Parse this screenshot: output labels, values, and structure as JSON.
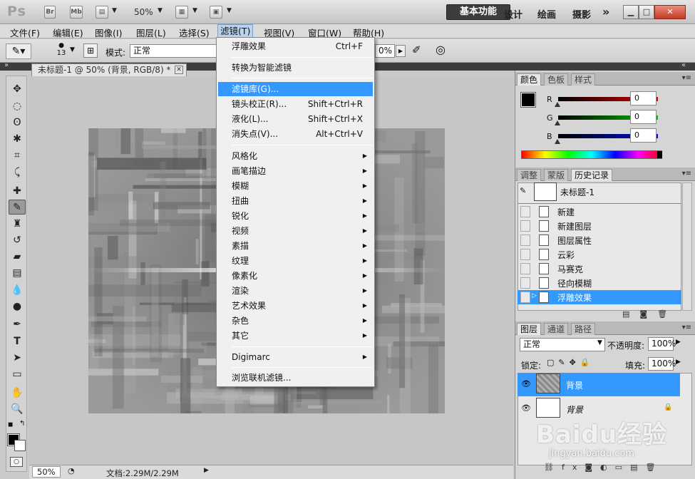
{
  "titlebar": {
    "logo": "Ps",
    "bridge_label": "Br",
    "minibridge_label": "Mb",
    "zoom_level": "50%",
    "workspaces": {
      "active": "基本功能",
      "design": "设计",
      "painting": "绘画",
      "photography": "摄影",
      "more": "»"
    }
  },
  "menubar": {
    "items": [
      "文件(F)",
      "编辑(E)",
      "图像(I)",
      "图层(L)",
      "选择(S)",
      "滤镜(T)",
      "视图(V)",
      "窗口(W)",
      "帮助(H)"
    ],
    "active": "滤镜(T)"
  },
  "options_bar": {
    "brush_size": "13",
    "mode_label": "模式:",
    "mode_value": "正常",
    "opacity_value": "0%"
  },
  "document": {
    "tab_title": "未标题-1 @ 50% (背景, RGB/8) *",
    "status_zoom": "50%",
    "status_doc": "文档:2.29M/2.29M"
  },
  "filter_menu": {
    "last_filter": {
      "label": "浮雕效果",
      "shortcut": "Ctrl+F"
    },
    "smart": "转换为智能滤镜",
    "gallery": "滤镜库(G)...",
    "lens": {
      "label": "镜头校正(R)...",
      "shortcut": "Shift+Ctrl+R"
    },
    "liquify": {
      "label": "液化(L)...",
      "shortcut": "Shift+Ctrl+X"
    },
    "vanishing": {
      "label": "消失点(V)...",
      "shortcut": "Alt+Ctrl+V"
    },
    "submenus": [
      "风格化",
      "画笔描边",
      "模糊",
      "扭曲",
      "锐化",
      "视频",
      "素描",
      "纹理",
      "像素化",
      "渲染",
      "艺术效果",
      "杂色",
      "其它"
    ],
    "digimarc": "Digimarc",
    "browse_online": "浏览联机滤镜..."
  },
  "color_panel": {
    "tabs": [
      "颜色",
      "色板",
      "样式"
    ],
    "r_label": "R",
    "g_label": "G",
    "b_label": "B",
    "r": "0",
    "g": "0",
    "b": "0"
  },
  "history_panel": {
    "tabs": [
      "调整",
      "蒙版",
      "历史记录"
    ],
    "snapshot": "未标题-1",
    "steps": [
      "新建",
      "新建图层",
      "图层属性",
      "云彩",
      "马赛克",
      "径向模糊",
      "浮雕效果"
    ],
    "selected": "浮雕效果"
  },
  "layers_panel": {
    "tabs": [
      "图层",
      "通道",
      "路径"
    ],
    "blend_mode": "正常",
    "opacity_label": "不透明度:",
    "opacity": "100%",
    "lock_label": "锁定:",
    "fill_label": "填充:",
    "fill": "100%",
    "layers": [
      "背景",
      "背景"
    ]
  },
  "watermark": {
    "logo": "Baidu经验",
    "url": "jingyan.baidu.com"
  },
  "colors": {
    "selection": "#3399ff",
    "dark_bar": "#3d3d3d"
  }
}
